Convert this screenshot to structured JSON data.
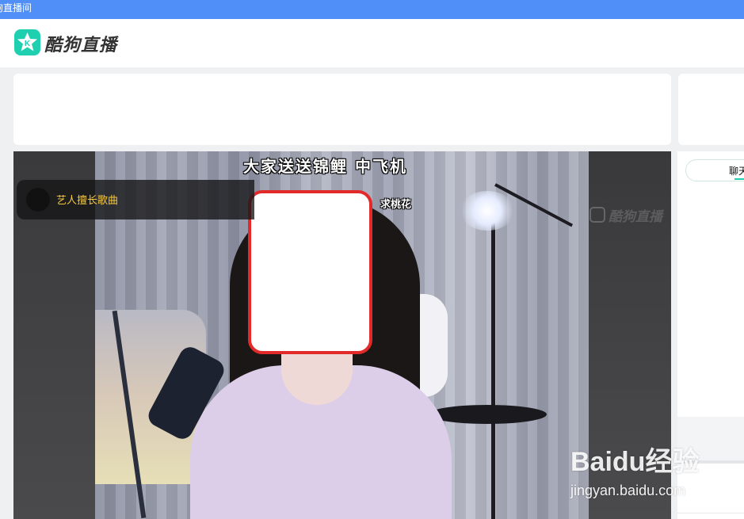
{
  "window": {
    "title": "狗直播间"
  },
  "header": {
    "logo_text": "酷狗直播",
    "brand_color": "#1fd0b0"
  },
  "video": {
    "caption_top": "大家送送锦鲤 中飞机",
    "caption_sub": "求桃花",
    "song_pill_label": "艺人擅长歌曲",
    "watermark_text": "酷狗直播"
  },
  "right_panel": {
    "chat_tab_label": "聊天"
  },
  "overlay_watermark": {
    "logo": "Baidu经验",
    "url": "jingyan.baidu.com"
  }
}
